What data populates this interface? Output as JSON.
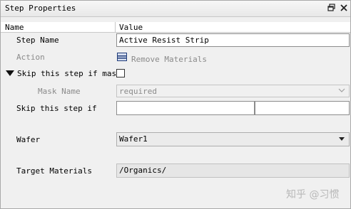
{
  "window": {
    "title": "Step Properties"
  },
  "table": {
    "col_name": "Name",
    "col_value": "Value"
  },
  "rows": {
    "step_name": {
      "label": "Step Name",
      "value": "Active Resist Strip"
    },
    "action": {
      "label": "Action",
      "value": "Remove Materials",
      "icon": "remove-materials-icon"
    },
    "skip_mask": {
      "label": "Skip this step if mask",
      "checked": false
    },
    "mask_name": {
      "label": "Mask Name",
      "value": "required"
    },
    "skip_if": {
      "label": "Skip this step if",
      "value1": "",
      "value2": ""
    },
    "wafer": {
      "label": "Wafer",
      "value": "Wafer1"
    },
    "target_materials": {
      "label": "Target Materials",
      "value": "/Organics/"
    }
  },
  "watermark": "知乎 @习惯"
}
